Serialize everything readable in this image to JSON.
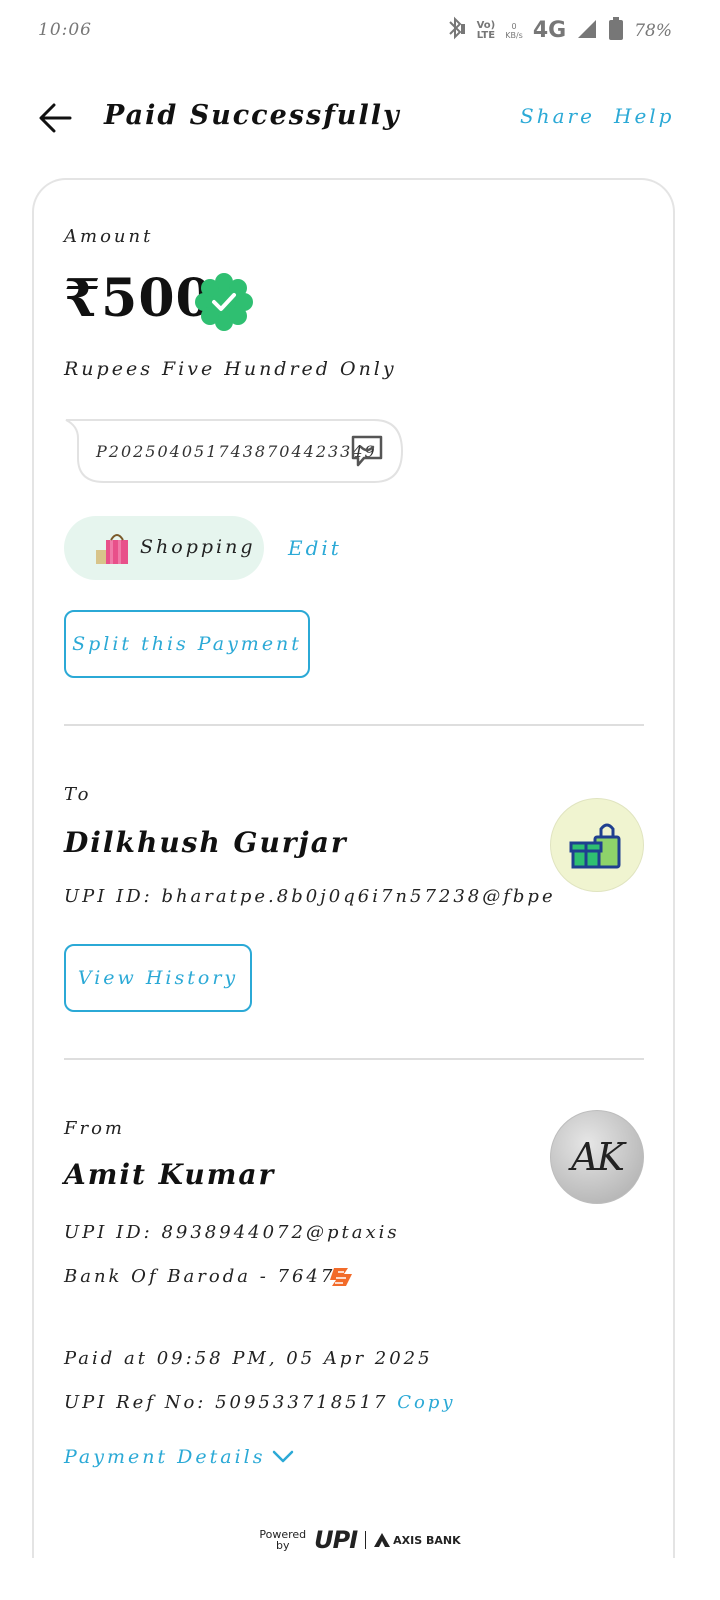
{
  "status_bar": {
    "time": "10:06",
    "volte_top": "Vo)",
    "volte_bottom": "LTE",
    "speed_top": "0",
    "speed_bottom": "KB/s",
    "network": "4G",
    "battery": "78%"
  },
  "header": {
    "title": "Paid Successfully",
    "share": "Share",
    "help": "Help"
  },
  "amount": {
    "label": "Amount",
    "value": "₹500",
    "in_words": "Rupees Five Hundred Only"
  },
  "note": {
    "text": "P20250405174387044233​49"
  },
  "category": {
    "label": "Shopping",
    "edit": "Edit"
  },
  "split_button": "Split this Payment",
  "to": {
    "label": "To",
    "name": "Dilkhush Gurjar",
    "upi": "UPI ID: bharatpe.8b0j0q6i7n57238@fbpe",
    "history_button": "View History"
  },
  "from": {
    "label": "From",
    "name": "Amit Kumar",
    "avatar_initials": "AK",
    "upi": "UPI ID: 8938944072@ptaxis",
    "bank": "Bank Of Baroda - 7647"
  },
  "payment": {
    "paid_at": "Paid at 09:58 PM, 05 Apr 2025",
    "ref_label": "UPI Ref No: 509533718517",
    "copy": "Copy",
    "details": "Payment Details"
  },
  "footer": {
    "powered_1": "Powered",
    "powered_2": "by",
    "upi": "UPI",
    "bank": "AXIS BANK"
  },
  "colors": {
    "accent": "#2ba9d6",
    "success": "#2fbf71",
    "chip_bg": "#e6f5ee"
  }
}
